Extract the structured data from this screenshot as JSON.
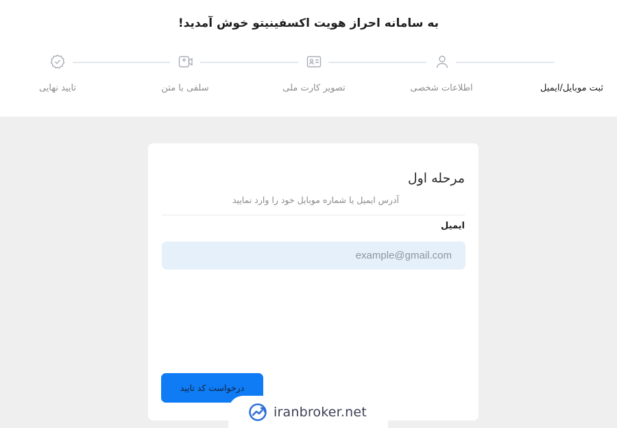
{
  "header": {
    "welcome": "به سامانه احراز هویت اکسفینیتو خوش آمدید!"
  },
  "steps": [
    {
      "label": "ثبت موبایل/ایمیل",
      "icon": "none",
      "active": true
    },
    {
      "label": "اطلاعات شخصی",
      "icon": "user-icon",
      "active": false
    },
    {
      "label": "تصویر کارت ملی",
      "icon": "id-card-icon",
      "active": false
    },
    {
      "label": "سلفی با متن",
      "icon": "video-camera-icon",
      "active": false
    },
    {
      "label": "تایید نهایی",
      "icon": "verified-badge-icon",
      "active": false
    }
  ],
  "card": {
    "title": "مرحله اول",
    "subtitle": "آدرس ایمیل یا شماره موبایل خود را وارد نمایید",
    "email_label": "ایمیل",
    "email_value": "",
    "email_placeholder": "example@gmail.com",
    "submit_label": "درخواست کد تایید"
  },
  "watermark": {
    "text": "iranbroker.net",
    "icon": "trend-chart-logo"
  },
  "colors": {
    "page_bg": "#efefef",
    "header_bg": "#ffffff",
    "accent": "#0f7cf5",
    "input_bg": "#e5f0fb",
    "muted_text": "#8d8d8d",
    "connector": "#e3e7ee"
  }
}
